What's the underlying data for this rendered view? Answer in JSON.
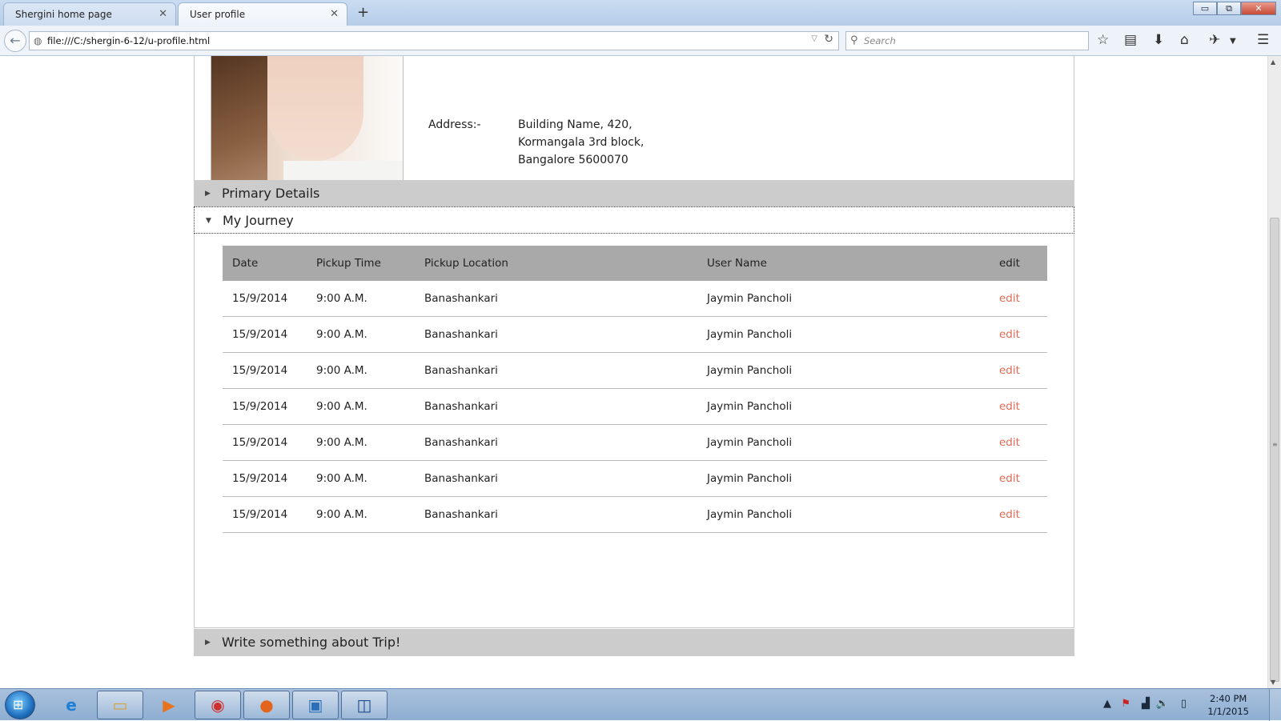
{
  "browser": {
    "tabs": [
      {
        "label": "Shergini home page",
        "close": "✕"
      },
      {
        "label": "User profile",
        "close": "✕"
      }
    ],
    "new_tab": "+",
    "url": "file:///C:/shergin-6-12/u-profile.html",
    "search_placeholder": "Search",
    "window_buttons": {
      "minimize": "▭",
      "restore": "⧉",
      "close": "✕"
    }
  },
  "profile": {
    "address_label": "Address:-",
    "address_lines": [
      "Building Name, 420,",
      "Kormangala 3rd block,",
      "Bangalore 5600070"
    ]
  },
  "accordion": {
    "primary_details": "Primary Details",
    "my_journey": "My Journey",
    "write_trip": "Write something about Trip!"
  },
  "journey_table": {
    "headers": [
      "Date",
      "Pickup Time",
      "Pickup Location",
      "User Name",
      "edit"
    ],
    "rows": [
      {
        "date": "15/9/2014",
        "time": "9:00 A.M.",
        "location": "Banashankari",
        "user": "Jaymin Pancholi",
        "edit": "edit"
      },
      {
        "date": "15/9/2014",
        "time": "9:00 A.M.",
        "location": "Banashankari",
        "user": "Jaymin Pancholi",
        "edit": "edit"
      },
      {
        "date": "15/9/2014",
        "time": "9:00 A.M.",
        "location": "Banashankari",
        "user": "Jaymin Pancholi",
        "edit": "edit"
      },
      {
        "date": "15/9/2014",
        "time": "9:00 A.M.",
        "location": "Banashankari",
        "user": "Jaymin Pancholi",
        "edit": "edit"
      },
      {
        "date": "15/9/2014",
        "time": "9:00 A.M.",
        "location": "Banashankari",
        "user": "Jaymin Pancholi",
        "edit": "edit"
      },
      {
        "date": "15/9/2014",
        "time": "9:00 A.M.",
        "location": "Banashankari",
        "user": "Jaymin Pancholi",
        "edit": "edit"
      },
      {
        "date": "15/9/2014",
        "time": "9:00 A.M.",
        "location": "Banashankari",
        "user": "Jaymin Pancholi",
        "edit": "edit"
      }
    ],
    "edit_color": "#e06a53",
    "header_bg": "#a9a9a9"
  },
  "taskbar": {
    "time": "2:40 PM",
    "date": "1/1/2015",
    "apps": [
      "internet-explorer-icon",
      "file-explorer-icon",
      "media-player-icon",
      "chrome-icon",
      "firefox-icon",
      "photo-viewer-icon",
      "app-icon"
    ]
  }
}
